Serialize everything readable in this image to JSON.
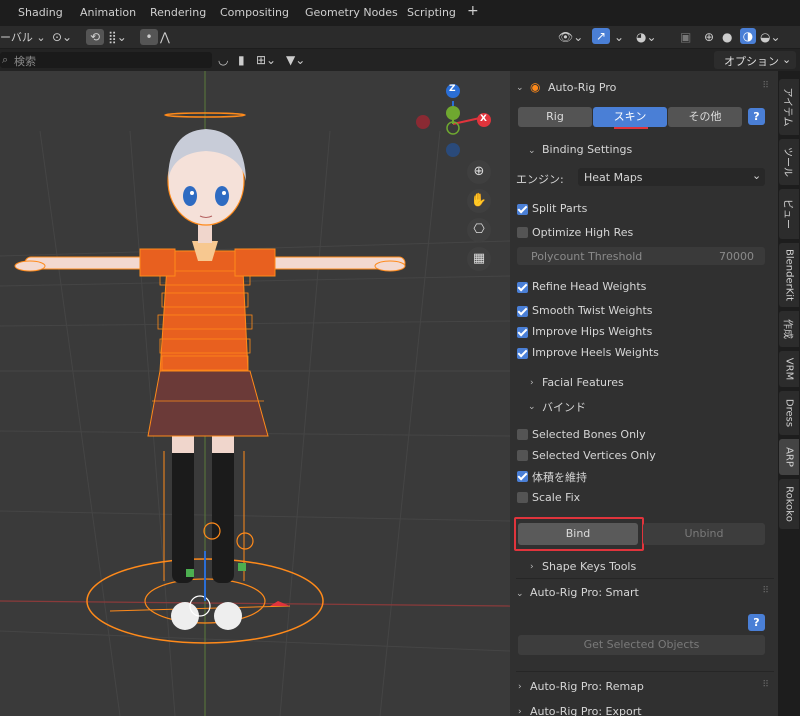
{
  "workspace_tabs": [
    "Shading",
    "Animation",
    "Rendering",
    "Compositing",
    "Geometry Nodes",
    "Scripting"
  ],
  "add_tab_icon": "plus-icon",
  "toolbar": {
    "mode_label": "ーバル"
  },
  "header2": {
    "search_placeholder": "検索",
    "options_label": "オプション"
  },
  "side_tabs": [
    "アイテム",
    "ツール",
    "ビュー",
    "BlenderKit",
    "作成",
    "VRM",
    "Dress",
    "ARP",
    "Rokoko"
  ],
  "panel": {
    "addon_title": "Auto-Rig Pro",
    "tabs": [
      "Rig",
      "スキン",
      "その他"
    ],
    "help_icon": "?",
    "binding_settings": "Binding Settings",
    "engine_label": "エンジン:",
    "engine_value": "Heat Maps",
    "split_parts": "Split Parts",
    "optimize_high_res": "Optimize High Res",
    "polycount_label": "Polycount Threshold",
    "polycount_value": "70000",
    "refine_head": "Refine Head Weights",
    "smooth_twist": "Smooth Twist Weights",
    "improve_hips": "Improve Hips Weights",
    "improve_heels": "Improve Heels Weights",
    "facial_features": "Facial Features",
    "bind_section": "バインド",
    "selected_bones_only": "Selected Bones Only",
    "selected_vertices_only": "Selected Vertices Only",
    "preserve_volume": "体積を維持",
    "scale_fix": "Scale Fix",
    "bind_button": "Bind",
    "unbind_button": "Unbind",
    "shape_keys_tools": "Shape Keys Tools",
    "smart_title": "Auto-Rig Pro: Smart",
    "get_selected_objects": "Get Selected Objects",
    "remap_title": "Auto-Rig Pro: Remap",
    "export_title": "Auto-Rig Pro: Export"
  },
  "gizmo": {
    "z": "Z",
    "x": "X"
  },
  "colors": {
    "accent": "#4a7fd6",
    "highlight_red": "#e0343c",
    "rig_orange": "#ff8a1a",
    "panel_bg": "#303030"
  }
}
